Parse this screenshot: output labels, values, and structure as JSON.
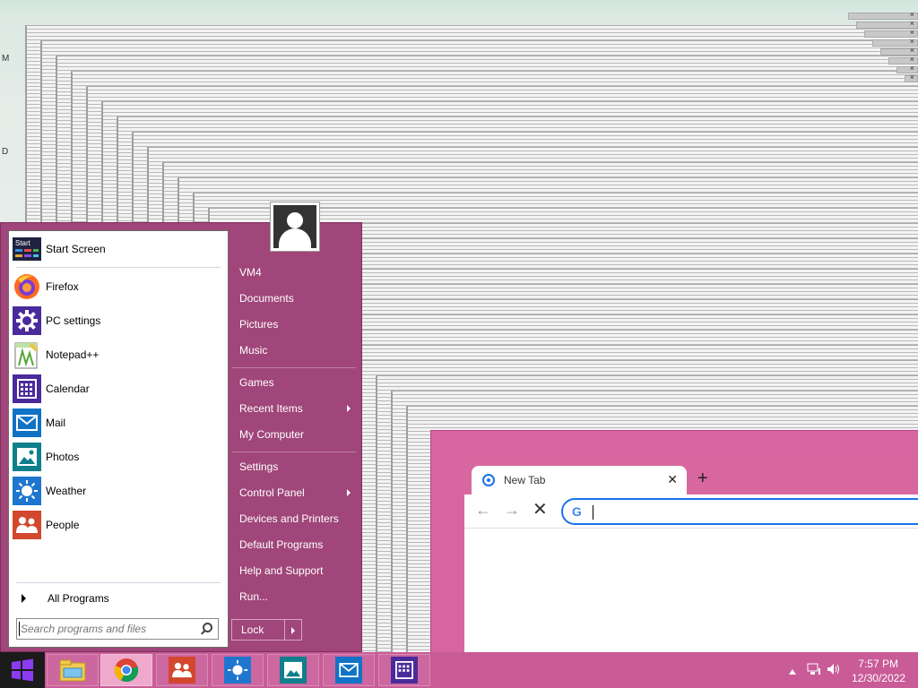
{
  "desktop": {
    "left_letters": [
      "M",
      "D"
    ],
    "ghost_close_glyph": "×"
  },
  "browser": {
    "tab_title": "New Tab",
    "tab_close": "✕",
    "new_tab": "+",
    "back": "←",
    "forward": "→",
    "stop": "✕",
    "omnibox_value": "",
    "google_letter": "G"
  },
  "start_menu": {
    "programs": [
      {
        "label": "Start Screen",
        "icon": "start-screen-icon"
      },
      {
        "label": "Firefox",
        "icon": "firefox-icon"
      },
      {
        "label": "PC settings",
        "icon": "gear-icon"
      },
      {
        "label": "Notepad++",
        "icon": "notepad-icon"
      },
      {
        "label": "Calendar",
        "icon": "calendar-icon"
      },
      {
        "label": "Mail",
        "icon": "mail-icon"
      },
      {
        "label": "Photos",
        "icon": "photos-icon"
      },
      {
        "label": "Weather",
        "icon": "weather-icon"
      },
      {
        "label": "People",
        "icon": "people-icon"
      }
    ],
    "start_tile_text": "Start",
    "all_programs": "All Programs",
    "search_placeholder": "Search programs and files",
    "right_items": [
      {
        "label": "VM4",
        "submenu": false
      },
      {
        "label": "Documents",
        "submenu": false
      },
      {
        "label": "Pictures",
        "submenu": false
      },
      {
        "label": "Music",
        "submenu": false
      },
      {
        "label": "Games",
        "submenu": false
      },
      {
        "label": "Recent Items",
        "submenu": true
      },
      {
        "label": "My Computer",
        "submenu": false
      },
      {
        "label": "Settings",
        "submenu": false
      },
      {
        "label": "Control Panel",
        "submenu": true
      },
      {
        "label": "Devices and Printers",
        "submenu": false
      },
      {
        "label": "Default Programs",
        "submenu": false
      },
      {
        "label": "Help and Support",
        "submenu": false
      },
      {
        "label": "Run...",
        "submenu": false
      }
    ],
    "lock_label": "Lock"
  },
  "taskbar": {
    "buttons": [
      "file-explorer-icon",
      "chrome-icon",
      "people-icon",
      "weather-icon",
      "photos-icon",
      "mail-icon",
      "calendar-icon"
    ],
    "active_button": "chrome-icon",
    "clock_time": "7:57 PM",
    "clock_date": "12/30/2022"
  },
  "colors": {
    "accent": "#a0467a",
    "taskbar": "#c95b97",
    "browser_frame": "#d765a0",
    "focus_blue": "#1a73e8"
  }
}
